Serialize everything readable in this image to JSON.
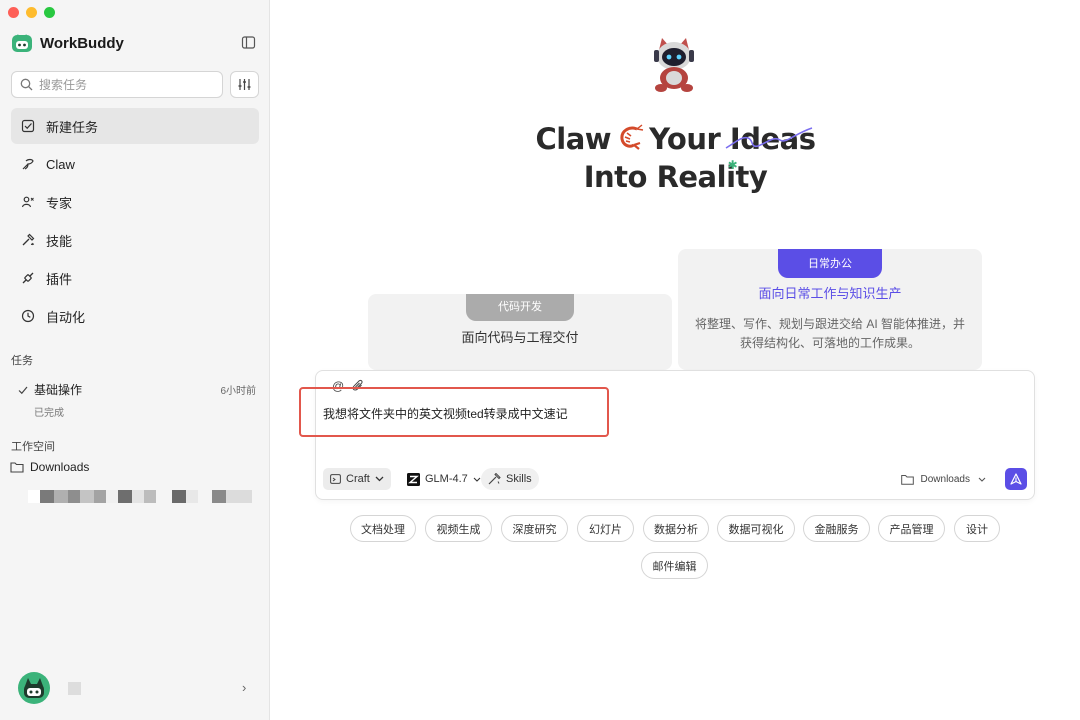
{
  "app": {
    "name": "WorkBuddy"
  },
  "sidebar": {
    "search_placeholder": "搜索任务",
    "nav": [
      {
        "label": "新建任务",
        "icon": "new-task-icon",
        "active": true
      },
      {
        "label": "Claw",
        "icon": "claw-icon"
      },
      {
        "label": "专家",
        "icon": "experts-icon"
      },
      {
        "label": "技能",
        "icon": "skills-icon"
      },
      {
        "label": "插件",
        "icon": "plugin-icon"
      },
      {
        "label": "自动化",
        "icon": "clock-icon"
      }
    ],
    "tasks_title": "任务",
    "task": {
      "name": "基础操作",
      "time": "6小时前",
      "status": "已完成"
    },
    "workspace_title": "工作空间",
    "workspace": {
      "folder": "Downloads"
    }
  },
  "main": {
    "hero": {
      "line1_a": "Claw",
      "line1_b": "Your",
      "line1_c": "Ideas",
      "line2_a": "Into",
      "line2_b": "Reality"
    },
    "cards": {
      "left": {
        "badge": "代码开发",
        "title": "面向代码与工程交付"
      },
      "right": {
        "badge": "日常办公",
        "title": "面向日常工作与知识生产",
        "desc_line1": "将整理、写作、规划与跟进交给 AI 智能体推进，并",
        "desc_line2": "获得结构化、可落地的工作成果。"
      }
    },
    "composer": {
      "at_symbol": "@",
      "attach_symbol": "⌀",
      "text": "我想将文件夹中的英文视频ted转录成中文速记",
      "mode": "Craft",
      "model": "GLM-4.7",
      "skills": "Skills",
      "folder": "Downloads"
    },
    "chips": [
      "文档处理",
      "视频生成",
      "深度研究",
      "幻灯片",
      "数据分析",
      "数据可视化",
      "金融服务",
      "产品管理",
      "设计",
      "邮件编辑"
    ]
  },
  "colors": {
    "accent": "#5b4ee6",
    "highlight": "#e2574c",
    "brand_green": "#3bb37a"
  }
}
